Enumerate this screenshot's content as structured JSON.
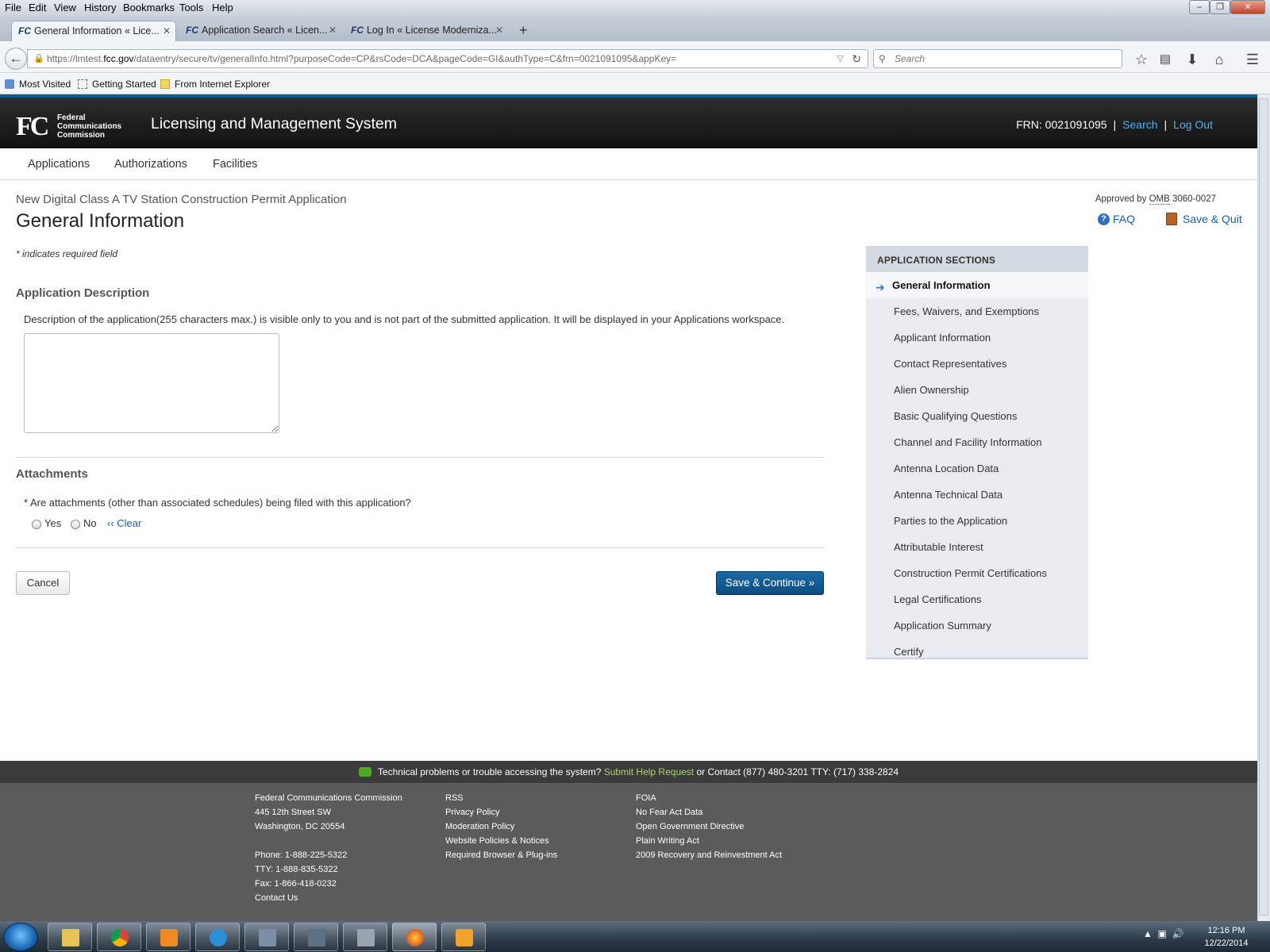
{
  "browser": {
    "menu": [
      "File",
      "Edit",
      "View",
      "History",
      "Bookmarks",
      "Tools",
      "Help"
    ],
    "tabs": [
      {
        "label": "General Information « Lice..."
      },
      {
        "label": "Application Search « Licen..."
      },
      {
        "label": "Log In « License Moderniza..."
      }
    ],
    "favicon_text": "FC",
    "url_prefix": "https://lmtest.",
    "url_domain": "fcc.gov",
    "url_rest": "/dataentry/secure/tv/generalInfo.html?purposeCode=CP&rsCode=DCA&pageCode=GI&authType=C&frn=0021091095&appKey=",
    "search_placeholder": "Search",
    "bookmarks": [
      "Most Visited",
      "Getting Started",
      "From Internet Explorer"
    ]
  },
  "header": {
    "logo_mark": "FC",
    "logo_line1": "Federal",
    "logo_line2": "Communications",
    "logo_line3": "Commission",
    "app_title": "Licensing and Management System",
    "frn": "FRN: 0021091095",
    "search_link": "Search",
    "logout_link": "Log Out"
  },
  "topnav": {
    "items": [
      "Applications",
      "Authorizations",
      "Facilities"
    ]
  },
  "page": {
    "subtitle": "New Digital Class A TV Station Construction Permit Application",
    "title": "General Information",
    "omb_prefix": "Approved by",
    "omb_abbr": "OMB",
    "omb_number": "3060-0027",
    "faq": "FAQ",
    "save_quit": "Save & Quit",
    "required_note": "* indicates required field"
  },
  "description": {
    "heading": "Application Description",
    "note": "Description of the application(255 characters max.) is visible only to you and is not part of the submitted application. It will be displayed in your Applications workspace.",
    "value": ""
  },
  "attachments": {
    "heading": "Attachments",
    "question": "* Are attachments (other than associated schedules) being filed with this application?",
    "yes": "Yes",
    "no": "No",
    "clear": "‹‹ Clear"
  },
  "buttons": {
    "cancel": "Cancel",
    "save_continue": "Save & Continue »"
  },
  "sidebar": {
    "heading": "APPLICATION SECTIONS",
    "items": [
      "General Information",
      "Fees, Waivers, and Exemptions",
      "Applicant Information",
      "Contact Representatives",
      "Alien Ownership",
      "Basic Qualifying Questions",
      "Channel and Facility Information",
      "Antenna Location Data",
      "Antenna Technical Data",
      "Parties to the Application",
      "Attributable Interest",
      "Construction Permit Certifications",
      "Legal Certifications",
      "Application Summary",
      "Certify"
    ]
  },
  "footer": {
    "help_text": "Technical problems or trouble accessing the system?",
    "help_link": "Submit Help Request",
    "help_contact": "or Contact (877) 480-3201 TTY: (717) 338-2824",
    "col1": [
      "Federal Communications Commission",
      "445 12th Street SW",
      "Washington, DC 20554",
      "",
      "Phone: 1-888-225-5322",
      "TTY: 1-888-835-5322",
      "Fax: 1-866-418-0232",
      "Contact Us"
    ],
    "col2": [
      "RSS",
      "Privacy Policy",
      "Moderation Policy",
      "Website Policies & Notices",
      "Required Browser & Plug-ins"
    ],
    "col3": [
      "FOIA",
      "No Fear Act Data",
      "Open Government Directive",
      "Plain Writing Act",
      "2009 Recovery and Reinvestment Act"
    ]
  },
  "taskbar": {
    "time": "12:16 PM",
    "date": "12/22/2014"
  },
  "colors": {
    "fcc_blue": "#1a5fa8",
    "header_bg": "#1a1a1a",
    "primary_button": "#0d4c82",
    "footer_link": "#a7d46b"
  }
}
